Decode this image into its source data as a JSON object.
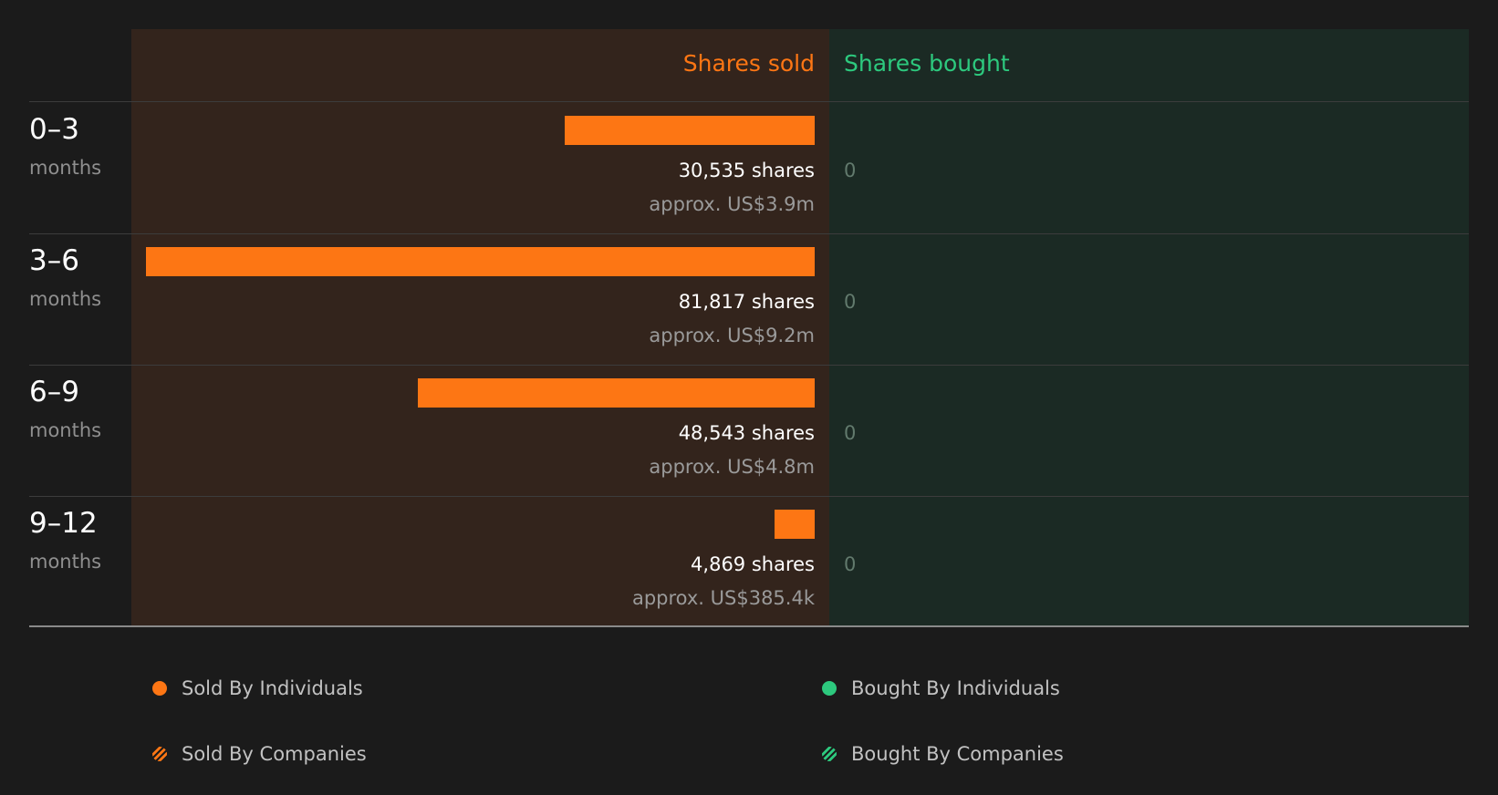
{
  "colors": {
    "sold": "#fd7614",
    "bought": "#2dc97e"
  },
  "header": {
    "sold": "Shares sold",
    "bought": "Shares bought"
  },
  "chart_data": {
    "type": "bar",
    "categories": [
      "0–3",
      "3–6",
      "6–9",
      "9–12"
    ],
    "category_unit": "months",
    "series": [
      {
        "name": "Shares sold",
        "values": [
          30535,
          81817,
          48543,
          4869
        ]
      },
      {
        "name": "Shares bought",
        "values": [
          0,
          0,
          0,
          0
        ]
      }
    ],
    "sold_labels": [
      "30,535 shares",
      "81,817 shares",
      "48,543 shares",
      "4,869 shares"
    ],
    "sold_approx": [
      "approx. US$3.9m",
      "approx. US$9.2m",
      "approx. US$4.8m",
      "approx. US$385.4k"
    ],
    "bought_labels": [
      "0",
      "0",
      "0",
      "0"
    ],
    "legend": [
      "Sold By Individuals",
      "Bought By Individuals",
      "Sold By Companies",
      "Bought By Companies"
    ]
  }
}
